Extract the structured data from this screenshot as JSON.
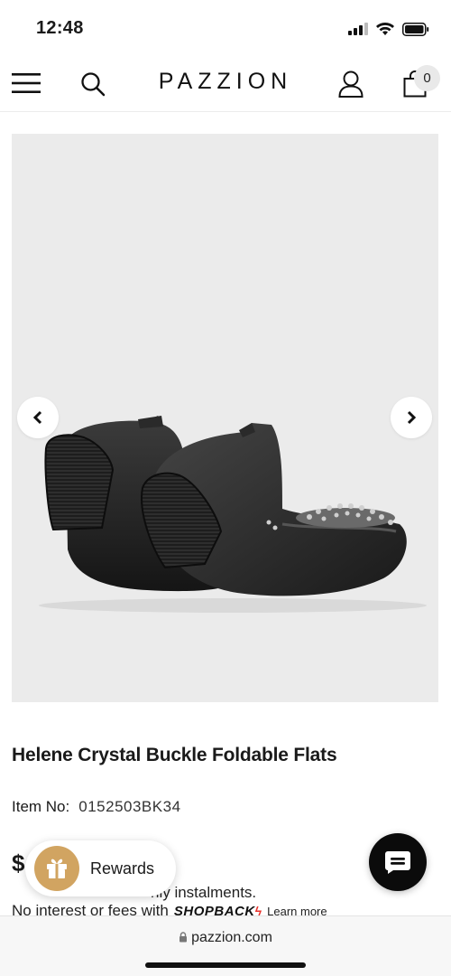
{
  "status_bar": {
    "time": "12:48",
    "icons": [
      "signal-icon",
      "wifi-icon",
      "battery-icon"
    ]
  },
  "header": {
    "brand": "PAZZION",
    "cart_count": "0",
    "icons": [
      "menu-icon",
      "search-icon",
      "account-icon",
      "cart-icon"
    ]
  },
  "product": {
    "title": "Helene Crystal Buckle Foldable Flats",
    "item_no_label": "Item No:",
    "item_no_value": "0152503BK34",
    "price_symbol": "$",
    "instalment_text": "or $... monthly instalments.",
    "instalment_visible": "nly instalments.",
    "no_interest_text": "No interest or fees with",
    "shopback_brand": "SHOPBACK",
    "learn_more": "Learn more"
  },
  "carousel": {
    "prev_icon": "chevron-left-icon",
    "next_icon": "chevron-right-icon"
  },
  "rewards": {
    "label": "Rewards",
    "icon": "gift-icon",
    "icon_color": "#d1a461"
  },
  "chat": {
    "icon": "chat-icon"
  },
  "browser": {
    "url": "pazzion.com",
    "icon": "lock-icon"
  }
}
